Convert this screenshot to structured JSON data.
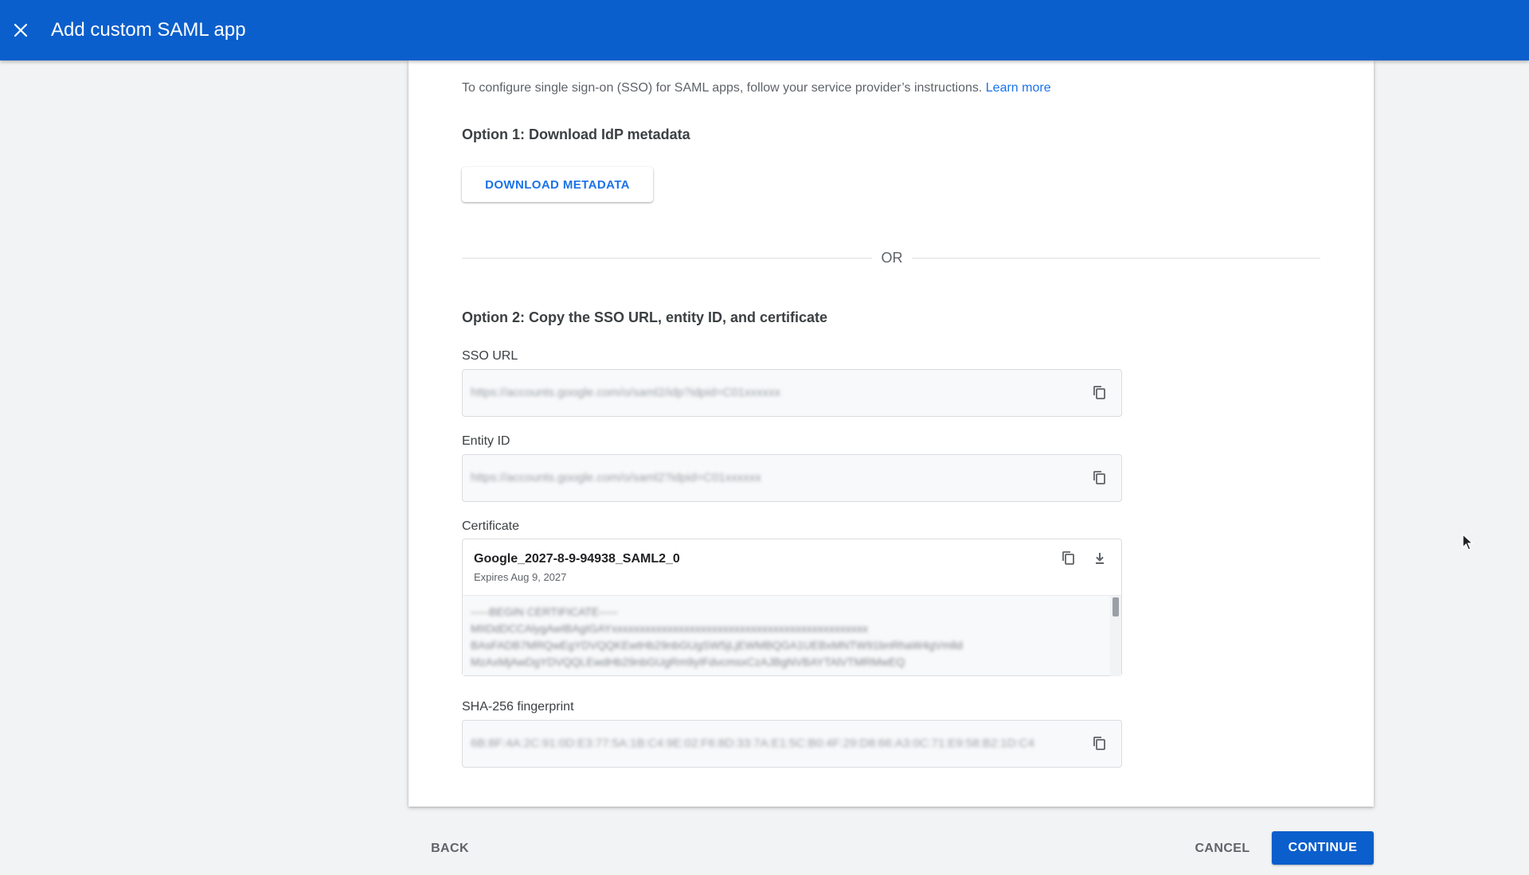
{
  "header": {
    "title": "Add custom SAML app",
    "close_icon": "close-icon"
  },
  "intro": {
    "text": "To configure single sign-on (SSO) for SAML apps, follow your service provider’s instructions.",
    "link": "Learn more"
  },
  "option1": {
    "title": "Option 1: Download IdP metadata",
    "button": "DOWNLOAD METADATA"
  },
  "divider": {
    "text": "OR"
  },
  "option2": {
    "title": "Option 2: Copy the SSO URL, entity ID, and certificate",
    "sso_url": {
      "label": "SSO URL",
      "value": "https://accounts.google.com/o/saml2/idp?idpid=C01xxxxxx"
    },
    "entity_id": {
      "label": "Entity ID",
      "value": "https://accounts.google.com/o/saml2?idpid=C01xxxxxx"
    },
    "certificate": {
      "label": "Certificate",
      "name": "Google_2027-8-9-94938_SAML2_0",
      "expires": "Expires Aug 9, 2027",
      "lines": [
        "-----BEGIN CERTIFICATE-----",
        "MIIDdDCCAlygAwIBAgIGAYxxxxxxxxxxxxxxxxxxxxxxxxxxxxxxxxxxxxxxxxxxxxxx",
        "BAsFADB7MRQwEgYDVQQKEwtHb29nbGUgSW5jLjEWMBQGA1UEBxMNTW91bnRhaW4gVmlld",
        "MzAxMjAwDgYDVQQLEwdHb29nbGUgRm9yIFdvcmsxCzAJBgNVBAYTAlVTMRMwEQ"
      ]
    },
    "fingerprint": {
      "label": "SHA-256 fingerprint",
      "value": "6B:8F:4A:2C:91:0D:E3:77:5A:1B:C4:9E:02:F6:8D:33:7A:E1:5C:B0:4F:29:D8:66:A3:0C:71:E9:58:B2:1D:C4"
    }
  },
  "footer": {
    "back": "BACK",
    "cancel": "CANCEL",
    "continue": "CONTINUE"
  },
  "colors": {
    "brand_blue": "#0b5fcc",
    "link_blue": "#1a73e8"
  },
  "icons": [
    "close-icon",
    "copy-icon",
    "download-icon",
    "mouse-pointer-icon"
  ]
}
